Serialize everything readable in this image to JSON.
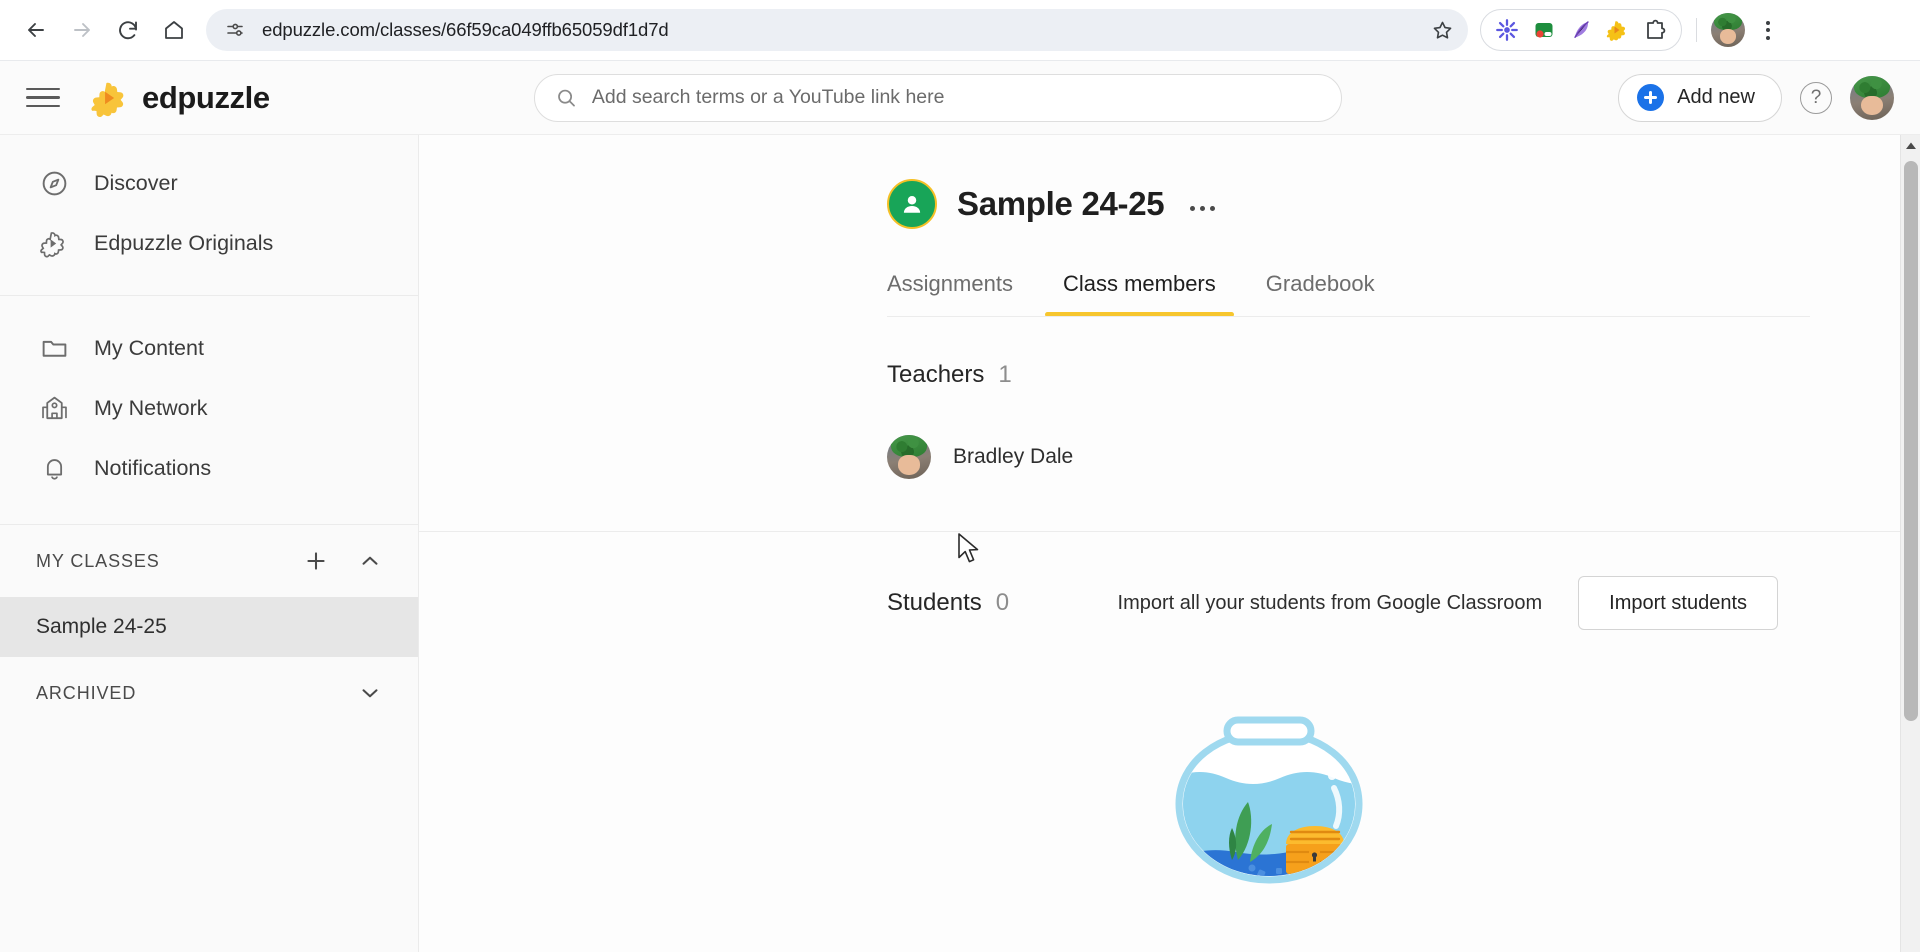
{
  "browser": {
    "back_icon": "back-arrow-icon",
    "forward_icon": "forward-arrow-icon",
    "reload_icon": "reload-icon",
    "home_icon": "home-icon",
    "site_info_icon": "site-settings-icon",
    "url": "edpuzzle.com/classes/66f59ca049ffb65059df1d7d",
    "bookmark_icon": "star-icon",
    "extensions": [
      {
        "name": "starburst-extension-icon",
        "color": "#5b57e0"
      },
      {
        "name": "screen-recorder-extension-icon",
        "color": "#34a853"
      },
      {
        "name": "quill-extension-icon",
        "color": "#8a63d2"
      },
      {
        "name": "edpuzzle-extension-icon",
        "color": "#f5c116"
      },
      {
        "name": "extensions-puzzle-icon",
        "color": "#3c4043"
      }
    ],
    "profile_avatar": "chrome-profile-avatar",
    "menu_icon": "three-dot-menu-icon"
  },
  "app_header": {
    "menu_icon": "hamburger-menu-icon",
    "logo_icon": "edpuzzle-logo-icon",
    "brand": "edpuzzle",
    "search": {
      "icon": "search-icon",
      "value": "",
      "placeholder": "Add search terms or a YouTube link here"
    },
    "add_new_label": "Add new",
    "help_label": "?",
    "avatar": "user-avatar"
  },
  "sidebar": {
    "nav_primary": [
      {
        "label": "Discover",
        "icon": "compass-icon"
      },
      {
        "label": "Edpuzzle Originals",
        "icon": "puzzle-piece-icon"
      }
    ],
    "nav_secondary": [
      {
        "label": "My Content",
        "icon": "folder-icon"
      },
      {
        "label": "My Network",
        "icon": "school-building-icon"
      },
      {
        "label": "Notifications",
        "icon": "bell-icon"
      }
    ],
    "my_classes": {
      "title": "MY CLASSES",
      "add_icon": "plus-icon",
      "collapse_icon": "chevron-up-icon",
      "classes": [
        {
          "label": "Sample 24-25",
          "active": true
        }
      ]
    },
    "archived": {
      "title": "ARCHIVED",
      "expand_icon": "chevron-down-icon"
    }
  },
  "main": {
    "class_avatar_icon": "class-people-icon",
    "class_title": "Sample 24-25",
    "options_icon": "more-options-icon",
    "tabs": [
      {
        "label": "Assignments",
        "active": false
      },
      {
        "label": "Class members",
        "active": true
      },
      {
        "label": "Gradebook",
        "active": false
      }
    ],
    "teachers": {
      "label": "Teachers",
      "count": "1",
      "members": [
        {
          "name": "Bradley Dale",
          "avatar": "teacher-avatar"
        }
      ]
    },
    "students": {
      "label": "Students",
      "count": "0",
      "import_text": "Import all your students from Google Classroom",
      "import_button": "Import students",
      "empty_illustration": "fishbowl-illustration"
    }
  },
  "scrollbar": {
    "up_arrow_icon": "scroll-up-arrow-icon",
    "thumb": "scrollbar-thumb"
  },
  "colors": {
    "brand_yellow": "#f5c116",
    "accent_blue": "#1b72e8",
    "class_green": "#18a558",
    "tab_underline": "#f7c62e"
  }
}
